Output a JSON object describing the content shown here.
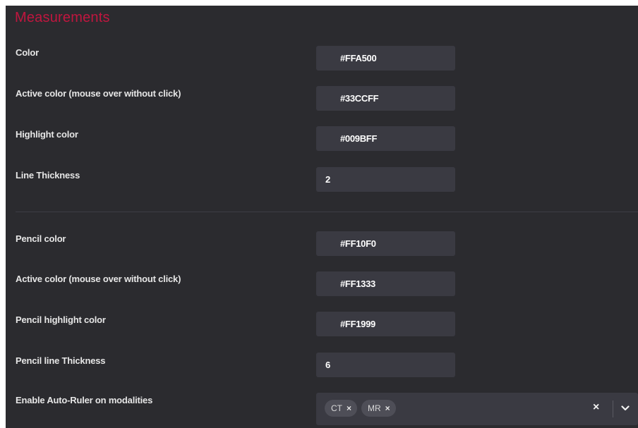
{
  "section": {
    "title": "Measurements"
  },
  "measurement": {
    "color": {
      "label": "Color",
      "value": "#FFA500",
      "swatch": "#FFA500"
    },
    "active_color": {
      "label": "Active color (mouse over without click)",
      "value": "#33CCFF",
      "swatch": "#33CCFF"
    },
    "highlight_color": {
      "label": "Highlight color",
      "value": "#009BFF",
      "swatch": "#009BFF"
    },
    "line_thickness": {
      "label": "Line Thickness",
      "value": "2"
    }
  },
  "pencil": {
    "color": {
      "label": "Pencil color",
      "value": "#FF10F0",
      "swatch": "#FF10F0"
    },
    "active_color": {
      "label": "Active color (mouse over without click)",
      "value": "#FF1333",
      "swatch": "#FF1333"
    },
    "highlight_color": {
      "label": "Pencil highlight color",
      "value": "#FF1999",
      "swatch": "#FF1999"
    },
    "line_thickness": {
      "label": "Pencil line Thickness",
      "value": "6"
    }
  },
  "auto_ruler": {
    "label": "Enable Auto-Ruler on modalities",
    "chips": [
      "CT",
      "MR"
    ],
    "chip_remove_glyph": "×",
    "clear_glyph": "×"
  },
  "icons": {
    "chip_remove": "close-icon",
    "clear": "close-icon",
    "dropdown": "chevron-down-icon"
  },
  "colors": {
    "panel_bg": "#2B2B2F",
    "field_bg": "#3A3A42",
    "title": "#C0163F"
  }
}
